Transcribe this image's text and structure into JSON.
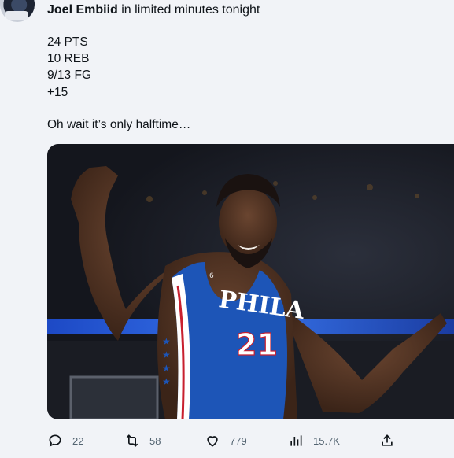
{
  "tweet": {
    "author": "Joel Embiid",
    "header_text": "in limited minutes tonight",
    "lines": [
      "24 PTS",
      "10 REB",
      "9/13 FG",
      "+15"
    ],
    "closing": "Oh wait it’s only halftime…",
    "jersey_text": "PHILA",
    "jersey_number": "21",
    "jersey_patch": "6"
  },
  "actions": {
    "replies": "22",
    "retweets": "58",
    "likes": "779",
    "views": "15.7K"
  },
  "icons": {
    "reply": "reply-icon",
    "retweet": "retweet-icon",
    "like": "heart-icon",
    "views": "views-icon",
    "share": "share-icon"
  },
  "colors": {
    "jersey_blue": "#1d55b7",
    "jersey_red": "#c8202f",
    "icon_gray": "#536471"
  }
}
